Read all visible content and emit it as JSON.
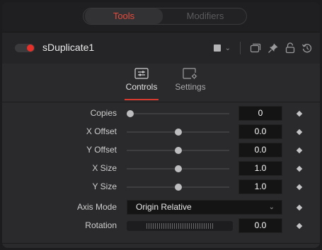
{
  "tabs": [
    {
      "label": "Tools",
      "active": true
    },
    {
      "label": "Modifiers",
      "active": false
    }
  ],
  "tool": {
    "name": "sDuplicate1",
    "enabled": true,
    "color_swatch": "#b4b4b6",
    "icons": [
      "square-swatch-icon",
      "chevron-down-icon",
      "window-icon",
      "pin-icon",
      "lock-icon",
      "reset-icon"
    ]
  },
  "control_tabs": [
    {
      "label": "Controls",
      "icon": "sliders-icon",
      "active": true
    },
    {
      "label": "Settings",
      "icon": "settings-gear-icon",
      "active": false
    }
  ],
  "params": {
    "copies": {
      "label": "Copies",
      "value": "0",
      "slider": 0.0
    },
    "x_offset": {
      "label": "X Offset",
      "value": "0.0",
      "slider": 0.5
    },
    "y_offset": {
      "label": "Y Offset",
      "value": "0.0",
      "slider": 0.5
    },
    "x_size": {
      "label": "X Size",
      "value": "1.0",
      "slider": 0.5
    },
    "y_size": {
      "label": "Y Size",
      "value": "1.0",
      "slider": 0.5
    },
    "axis_mode": {
      "label": "Axis Mode",
      "value": "Origin Relative"
    },
    "rotation": {
      "label": "Rotation",
      "value": "0.0"
    }
  },
  "colors": {
    "accent": "#e64b3c",
    "enabled_dot": "#e6302a",
    "active_underline": "#d93a2f"
  }
}
